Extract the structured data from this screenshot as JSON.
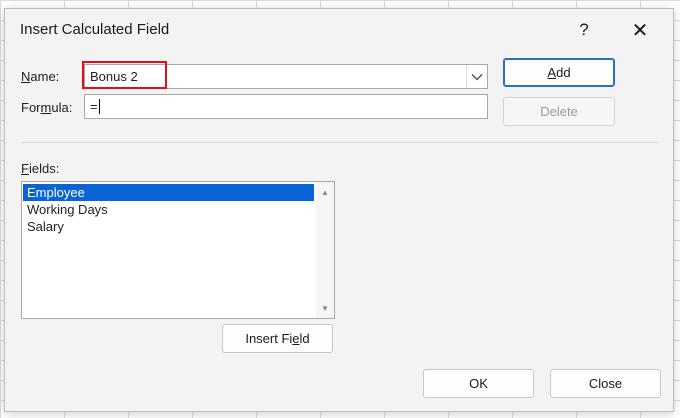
{
  "dialog": {
    "title": "Insert Calculated Field",
    "help_label": "?",
    "close_label": "✕"
  },
  "name_field": {
    "label_underlined": "N",
    "label_rest": "ame:",
    "value": "Bonus 2",
    "dropdown_icon": "chevron-down-icon"
  },
  "formula_field": {
    "label_pre": "For",
    "label_underlined": "m",
    "label_post": "ula:",
    "value": "="
  },
  "buttons": {
    "add_underlined": "A",
    "add_rest": "dd",
    "delete": "Delete",
    "insert_field_pre": "Insert Fi",
    "insert_field_underlined": "e",
    "insert_field_post": "ld",
    "ok": "OK",
    "close": "Close"
  },
  "fields": {
    "label_underlined": "F",
    "label_rest": "ields:",
    "items": [
      "Employee",
      "Working Days",
      "Salary"
    ],
    "selected_index": 0
  },
  "colors": {
    "selection": "#0a64d6",
    "highlight_box": "#e0101a",
    "primary_border": "#2a6fc9"
  }
}
